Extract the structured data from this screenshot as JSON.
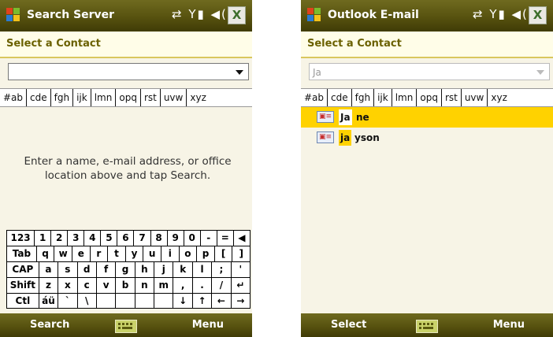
{
  "screens": [
    {
      "title": "Search Server",
      "status_icons": "⇄ Y▮ ◀(",
      "close_label": "X",
      "heading": "Select a Contact",
      "search": {
        "value": ""
      },
      "alpha_tabs": [
        "#ab",
        "cde",
        "fgh",
        "ijk",
        "lmn",
        "opq",
        "rst",
        "uvw",
        "xyz"
      ],
      "message": "Enter a name, e-mail address, or office location above and tap Search.",
      "keyboard": [
        [
          "123",
          "1",
          "2",
          "3",
          "4",
          "5",
          "6",
          "7",
          "8",
          "9",
          "0",
          "-",
          "=",
          "◀"
        ],
        [
          "Tab",
          "q",
          "w",
          "e",
          "r",
          "t",
          "y",
          "u",
          "i",
          "o",
          "p",
          "[",
          "]"
        ],
        [
          "CAP",
          "a",
          "s",
          "d",
          "f",
          "g",
          "h",
          "j",
          "k",
          "l",
          ";",
          "'"
        ],
        [
          "Shift",
          "z",
          "x",
          "c",
          "v",
          "b",
          "n",
          "m",
          ",",
          ".",
          "/",
          "↵"
        ],
        [
          "Ctl",
          "áü",
          "`",
          "\\",
          "",
          "",
          "",
          "",
          "↓",
          "↑",
          "←",
          "→"
        ]
      ],
      "softkey_left": "Search",
      "softkey_right": "Menu"
    },
    {
      "title": "Outlook E-mail",
      "status_icons": "⇄ Y▮ ◀(",
      "close_label": "X",
      "heading": "Select a Contact",
      "search": {
        "value": "Ja"
      },
      "alpha_tabs": [
        "#ab",
        "cde",
        "fgh",
        "ijk",
        "lmn",
        "opq",
        "rst",
        "uvw",
        "xyz"
      ],
      "results": [
        {
          "match": "Ja",
          "rest": "ne"
        },
        {
          "match": "ja",
          "rest": "yson"
        }
      ],
      "softkey_left": "Select",
      "softkey_right": "Menu"
    }
  ],
  "colors": {
    "titlebar": "#57520f",
    "accent": "#ffd200",
    "background": "#f7f4e6"
  }
}
